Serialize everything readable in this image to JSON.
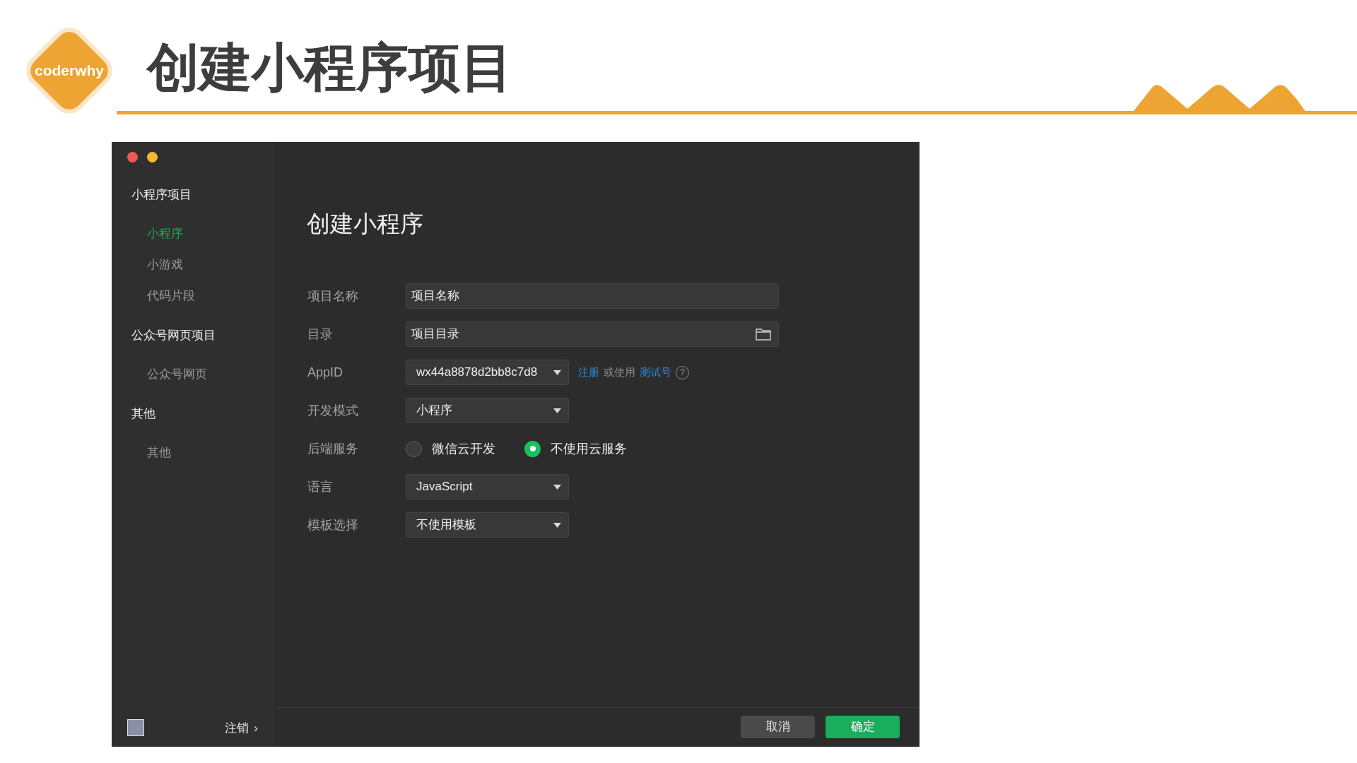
{
  "slide": {
    "logo": "coderwhy",
    "title": "创建小程序项目"
  },
  "window": {
    "sidebar": {
      "groups": [
        {
          "label": "小程序项目",
          "items": [
            {
              "label": "小程序",
              "selected": true
            },
            {
              "label": "小游戏",
              "selected": false
            },
            {
              "label": "代码片段",
              "selected": false
            }
          ]
        },
        {
          "label": "公众号网页项目",
          "items": [
            {
              "label": "公众号网页",
              "selected": false
            }
          ]
        },
        {
          "label": "其他",
          "items": [
            {
              "label": "其他",
              "selected": false
            }
          ]
        }
      ],
      "logout": "注销",
      "logout_chevron": "›"
    },
    "heading": "创建小程序",
    "form": [
      {
        "kind": "text",
        "label": "项目名称",
        "value": "项目名称"
      },
      {
        "kind": "folder",
        "label": "目录",
        "value": "项目目录"
      },
      {
        "kind": "appid",
        "label": "AppID",
        "value": "wx44a8878d2bb8c7d8",
        "register_link": "注册",
        "or_text": "或使用",
        "test_link": "测试号",
        "help": "?"
      },
      {
        "kind": "select",
        "label": "开发模式",
        "value": "小程序"
      },
      {
        "kind": "radio",
        "label": "后端服务",
        "options": [
          {
            "label": "微信云开发",
            "selected": false
          },
          {
            "label": "不使用云服务",
            "selected": true
          }
        ]
      },
      {
        "kind": "select",
        "label": "语言",
        "value": "JavaScript"
      },
      {
        "kind": "select",
        "label": "模板选择",
        "value": "不使用模板"
      }
    ],
    "buttons": [
      {
        "label": "取消",
        "kind": "secondary"
      },
      {
        "label": "确定",
        "kind": "primary"
      }
    ]
  }
}
